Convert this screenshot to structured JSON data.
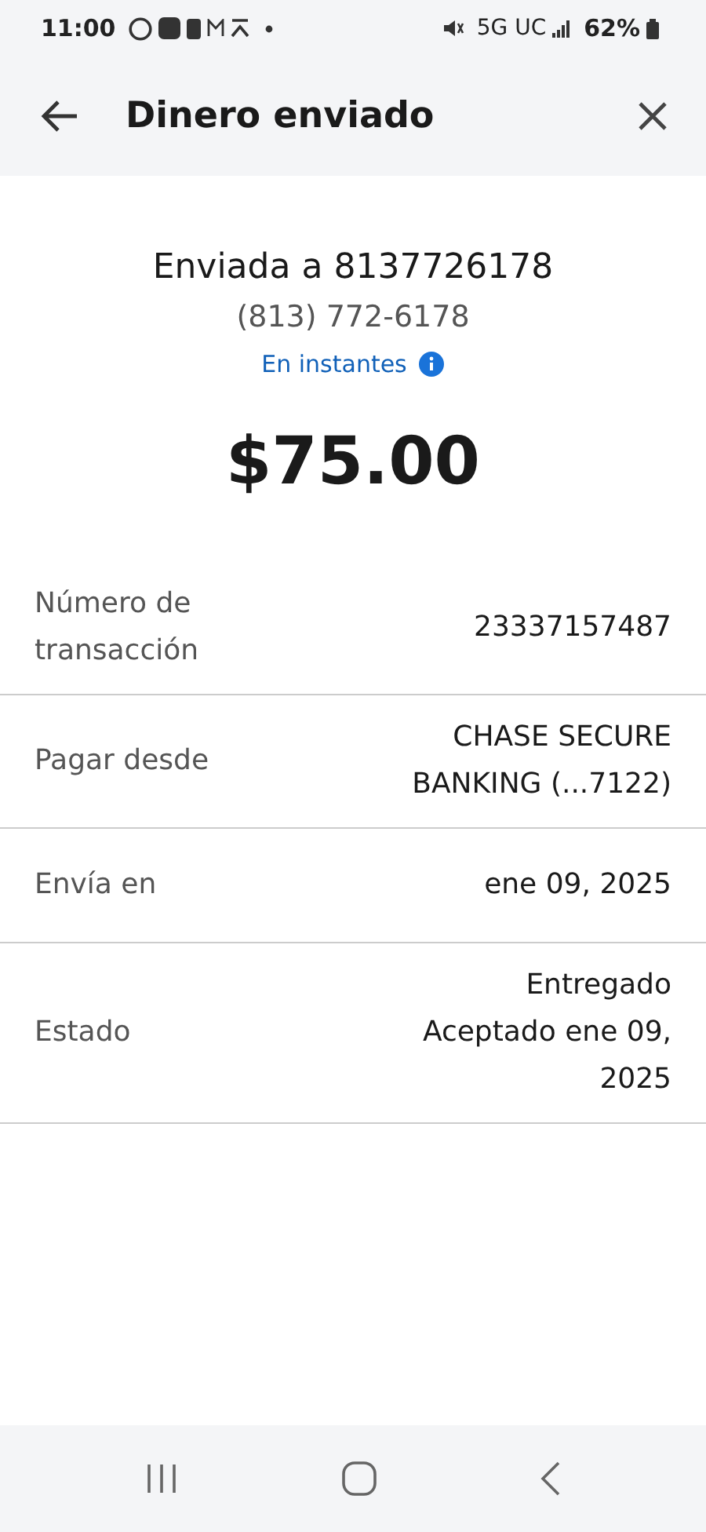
{
  "status_bar": {
    "time": "11:00",
    "network": "5G UC",
    "battery": "62%"
  },
  "header": {
    "title": "Dinero enviado"
  },
  "summary": {
    "recipient": "Enviada a 8137726178",
    "phone": "(813) 772-6178",
    "speed": "En instantes",
    "amount": "$75.00"
  },
  "details": [
    {
      "label": "Número de transacción",
      "value": "23337157487"
    },
    {
      "label": "Pagar desde",
      "value": "CHASE SECURE BANKING (...7122)"
    },
    {
      "label": "Envía en",
      "value": "ene 09, 2025"
    },
    {
      "label": "Estado",
      "value": "Entregado Aceptado ene 09, 2025"
    }
  ]
}
